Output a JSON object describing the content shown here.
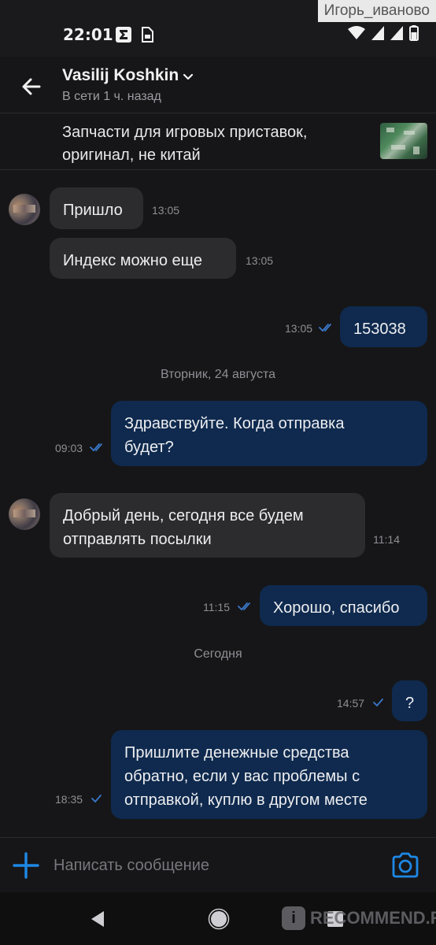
{
  "status_bar": {
    "time": "22:01",
    "watermark_user": "Игорь_иваново"
  },
  "header": {
    "contact_name": "Vasilij Koshkin",
    "status": "В сети 1 ч. назад"
  },
  "listing": {
    "title": "Запчасти для игровых приставок, оригинал, не китай"
  },
  "messages": [
    {
      "direction": "in",
      "text": "Пришло",
      "time": "13:05"
    },
    {
      "direction": "in",
      "text": "Индекс можно еще",
      "time": "13:05"
    },
    {
      "direction": "out",
      "text": "153038",
      "time": "13:05",
      "read": true
    },
    {
      "direction": "out",
      "text": "Здравствуйте. Когда отправка\nбудет?",
      "time": "09:03",
      "read": true
    },
    {
      "direction": "in",
      "text": "Добрый день, сегодня все будем\nотправлять посылки",
      "time": "11:14"
    },
    {
      "direction": "out",
      "text": "Хорошо, спасибо",
      "time": "11:15",
      "read": true
    },
    {
      "direction": "out",
      "text": "?",
      "time": "14:57",
      "read": false
    },
    {
      "direction": "out",
      "text": "Пришлите денежные средства\nобратно, если у вас проблемы с\nотправкой, куплю в другом месте",
      "time": "18:35",
      "read": false
    }
  ],
  "date_dividers": [
    "Вторник, 24 августа",
    "Сегодня"
  ],
  "input": {
    "placeholder": "Написать сообщение"
  },
  "watermark": {
    "text": "RECOMMEND.RU",
    "badge": "i"
  },
  "colors": {
    "background": "#161618",
    "incoming_bubble": "#2c2c2f",
    "outgoing_bubble": "#0f2a4e",
    "accent": "#1e88e5",
    "read_check": "#3a78c9"
  }
}
